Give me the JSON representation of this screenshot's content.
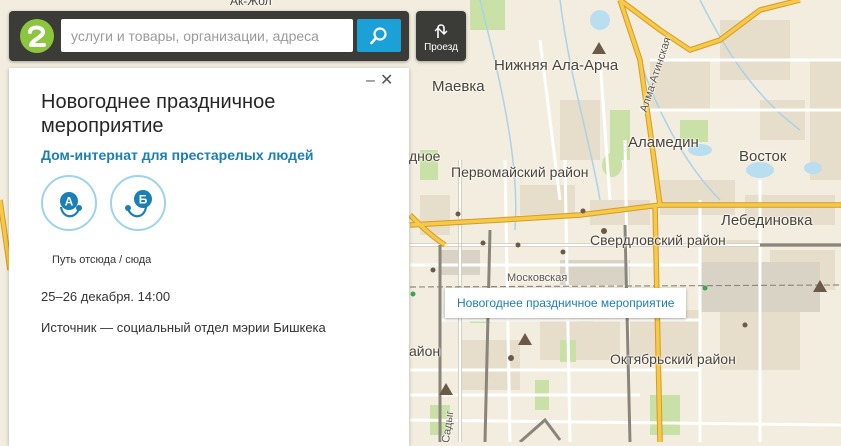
{
  "search": {
    "placeholder": "услуги и товары, организации, адреса",
    "value": ""
  },
  "route_button": {
    "label": "Проезд"
  },
  "card": {
    "title": "Новогоднее праздничное мероприятие",
    "subtitle": "Дом-интернат для престарелых людей",
    "route_from_letter": "А",
    "route_to_letter": "Б",
    "route_caption": "Путь отсюда / сюда",
    "date": "25–26 декабря. 14:00",
    "source": "Источник — социальный отдел мэрии Бишкека",
    "minimize_symbol": "–",
    "close_symbol": "✕"
  },
  "tooltip": {
    "text": "Новогоднее праздничное мероприятие"
  },
  "map": {
    "labels": {
      "nizhnyaya_ala_archa": "Нижняя Ала-Арча",
      "maevka": "Маевка",
      "alamedin": "Аламедин",
      "vostok": "Восток",
      "pervomaisky": "Первомайский район",
      "lebedinovka": "Лебединовка",
      "sverdlovsky": "Свердловский район",
      "moskovskaya": "Московская",
      "oktyabrsky": "Октябрьский район",
      "alma_atinskaya": "Алма-Атинская",
      "ak_zhol": "Ак-Жол",
      "partial_noe": "дное",
      "partial_ion": "айон",
      "partial_sadyg": "Садыг"
    }
  },
  "colors": {
    "accent": "#1ba1d8",
    "logo_green": "#8cc63f",
    "topbar": "#3b3b38",
    "link": "#1a7fb5",
    "road_major": "#f2b233",
    "map_bg": "#f3eddf"
  },
  "icons": {
    "logo": "2gis-logo-icon",
    "search": "search-icon",
    "route": "route-icon",
    "minimize": "minimize-icon",
    "close": "close-icon"
  }
}
